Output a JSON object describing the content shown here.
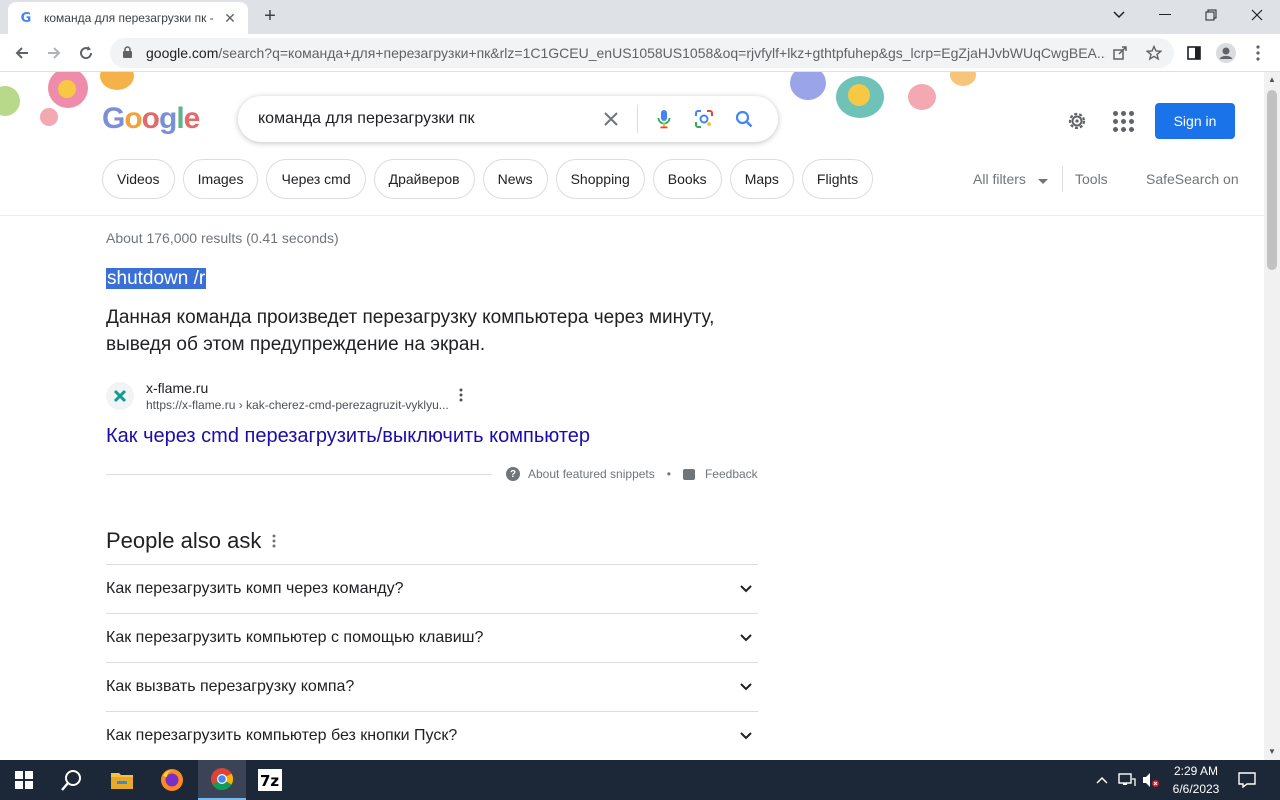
{
  "browser": {
    "tab_title": "команда для перезагрузки пк -",
    "tab_close": "✕",
    "new_tab": "+",
    "url_host": "google.com",
    "url_rest": "/search?q=команда+для+перезагрузки+пк&rlz=1C1GCEU_enUS1058US1058&oq=rjvfylf+lkz+gthtpfuhep&gs_lcrp=EgZjaHJvbWUqCwgBEA..."
  },
  "google": {
    "logo_letters": [
      "G",
      "o",
      "o",
      "g",
      "l",
      "e"
    ],
    "query": "команда для перезагрузки пк",
    "signin_label": "Sign in",
    "chips": [
      "Videos",
      "Images",
      "Через cmd",
      "Драйверов",
      "News",
      "Shopping",
      "Books",
      "Maps",
      "Flights"
    ],
    "all_filters": "All filters",
    "tools": "Tools",
    "safesearch": "SafeSearch on"
  },
  "results": {
    "stats": "About 176,000 results (0.41 seconds)",
    "featured_answer": "shutdown /r",
    "snippet": "Данная команда произведет перезагрузку компьютера через минуту, выведя об этом предупреждение на экран.",
    "source_name": "x-flame.ru",
    "source_url": "https://x-flame.ru › kak-cherez-cmd-perezagruzit-vyklyu...",
    "link_title": "Как через cmd перезагрузить/выключить компьютер",
    "about_snippets": "About featured snippets",
    "feedback": "Feedback"
  },
  "paa": {
    "title": "People also ask",
    "questions": [
      "Как перезагрузить комп через команду?",
      "Как перезагрузить компьютер с помощью клавиш?",
      "Как вызвать перезагрузку компа?",
      "Как перезагрузить компьютер без кнопки Пуск?"
    ]
  },
  "taskbar": {
    "time": "2:29 AM",
    "date": "6/6/2023"
  }
}
